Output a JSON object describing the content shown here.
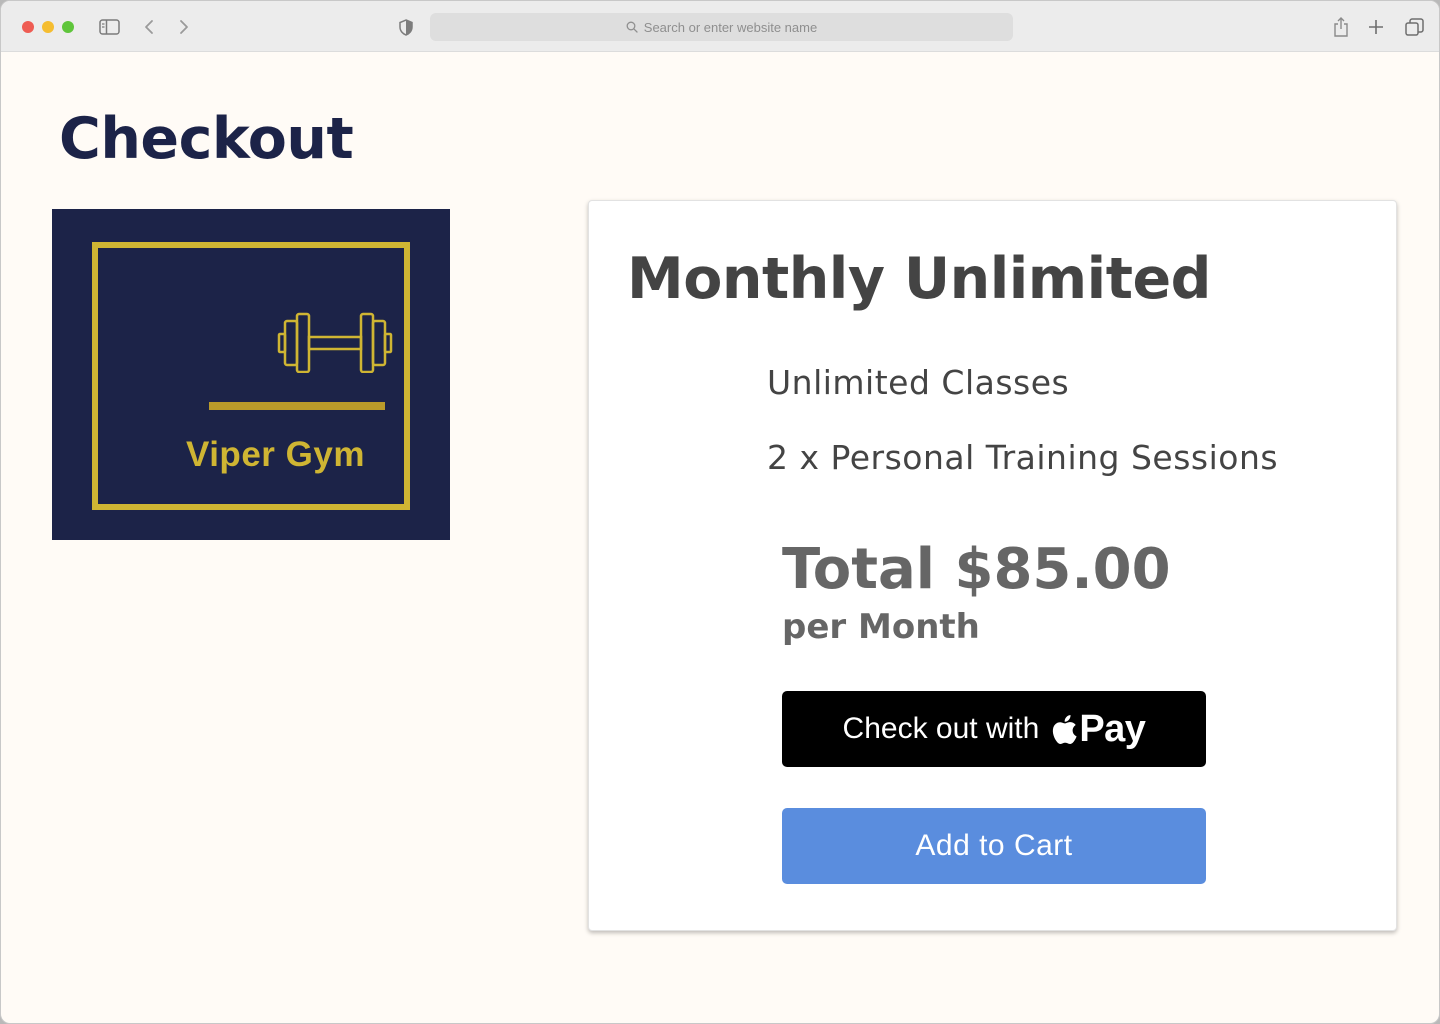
{
  "browser": {
    "address_placeholder": "Search or enter website name"
  },
  "page": {
    "title": "Checkout"
  },
  "logo": {
    "text": "Viper Gym",
    "colors": {
      "background": "#1c2348",
      "accent": "#cfb533"
    }
  },
  "plan": {
    "name": "Monthly Unlimited",
    "features": [
      "Unlimited Classes",
      "2 x Personal Training Sessions"
    ],
    "total_label": "Total $85.00",
    "period": "per Month"
  },
  "buttons": {
    "apple_pay_prefix": "Check out with",
    "apple_pay_word": "Pay",
    "add_to_cart": "Add to Cart"
  },
  "colors": {
    "title": "#1c2348",
    "apple_pay_bg": "#000000",
    "cart_bg": "#5a8dde"
  }
}
